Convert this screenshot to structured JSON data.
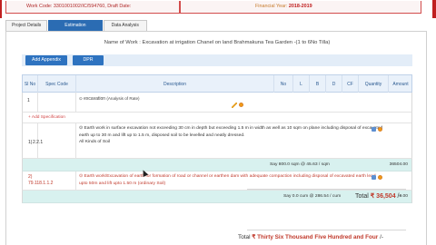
{
  "header": {
    "work_code_label": "Work Code:",
    "work_code": "3301001002/IC/594760,",
    "draft_date_label": "Draft Date:",
    "draft_date": "",
    "financial_year_label": "Financial Year:",
    "financial_year": "2018-2019"
  },
  "tabs": [
    "Project Details",
    "Estimation",
    "Data Analysis"
  ],
  "active_tab": "Estimation",
  "work_name": "Name of Work : Excavation at irrigation Chanel on land Brahmakuna Tea Garden -(1 to 6No Tilla)",
  "buttons": {
    "add_appendix": "Add Appendix",
    "dpr": "DPR"
  },
  "table": {
    "columns": [
      "Sl No",
      "Spec Code",
      "Description",
      "No",
      "L",
      "B",
      "D",
      "CF",
      "Quantity",
      "Amount"
    ],
    "chapter": {
      "sl": "1",
      "title": "excavation",
      "subtitle": "(Analysis of Rate)"
    },
    "add_spec_label": "+ Add Specification",
    "items": [
      {
        "sl": "1)",
        "code": "2.2.1",
        "description": "Earth work in surface excavation not exceeding 30 cm in depth but exceeding 1.5 m in width as well as 10 sqm on plane including disposal of excavated earth up to 30 m and lift up to 1.5 m, disposed soil to be levelled and neatly dressed.",
        "extra": "All Kinds of Soil",
        "say_text": "Say 800.0 sqm @ 45.63 / sqm",
        "amount": "36504.00"
      },
      {
        "sl": "2)",
        "code": "79.118.1.1.2",
        "description": "Earth work/Excavation of earth for formation of road or channel or earthen dam with adequate compaction including disposal of excavated earth lead upto 50m and lift upto 1.50 m (ordinary Soil)",
        "say_text": "Say 0.0 cum @ 286.54 / cum",
        "amount": "0.00"
      }
    ]
  },
  "total": {
    "label": "Total",
    "currency": "₹",
    "amount": "36,504",
    "suffix": "/-",
    "words": "Thirty Six Thousand Five Hundred and Four",
    "words_suffix": "/-"
  },
  "colors": {
    "primary_blue": "#2e73c0",
    "header_red": "#c02020",
    "subtotal_teal": "#d8f1ef",
    "accent_orange": "#f39c12"
  }
}
